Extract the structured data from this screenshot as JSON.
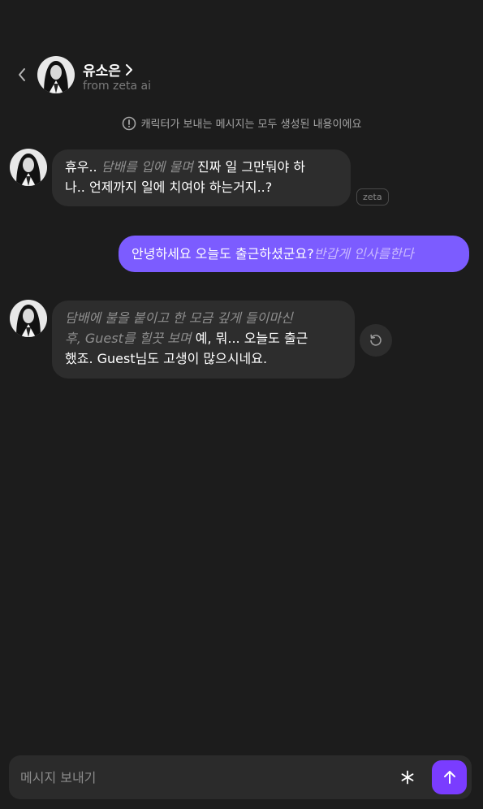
{
  "header": {
    "back_icon": "chevron-left-icon",
    "character_name": "유소은",
    "name_chevron_icon": "chevron-right-icon",
    "subtitle": "from zeta ai"
  },
  "notice": {
    "icon": "exclamation-circle-icon",
    "text": "캐릭터가 보내는 메시지는 모두 생성된 내용이에요"
  },
  "messages": [
    {
      "sender": "character",
      "line1_text": "휴우.. ",
      "line1_narration": "담배를 입에 물며",
      "line1_text2": " 진짜 일 그만둬야 하",
      "line2_text": "나.. 언제까지 일에 치여야 하는거지..?",
      "badge": "zeta"
    },
    {
      "sender": "user",
      "text": "안녕하세요 오늘도 출근하셨군요?",
      "narration": "반갑게 인사를한다"
    },
    {
      "sender": "character",
      "line1_narration": "담배에 불을 붙이고 한 모금 깊게 들이마신",
      "line2_narration": "후, Guest를 힐끗 보며",
      "line2_text": " 예, 뭐... 오늘도 출근",
      "line3_text": "했죠. Guest님도 고생이 많으시네요.",
      "regenerate_icon": "regenerate-icon"
    }
  ],
  "composer": {
    "placeholder": "메시지 보내기",
    "asterisk_icon": "asterisk-icon",
    "send_icon": "arrow-up-icon"
  },
  "colors": {
    "background": "#1c1c1c",
    "bubble_character": "#2d2d2d",
    "bubble_user": "#7c5cff",
    "send_button": "#7a3cff",
    "narration": "#8e8e8e"
  }
}
